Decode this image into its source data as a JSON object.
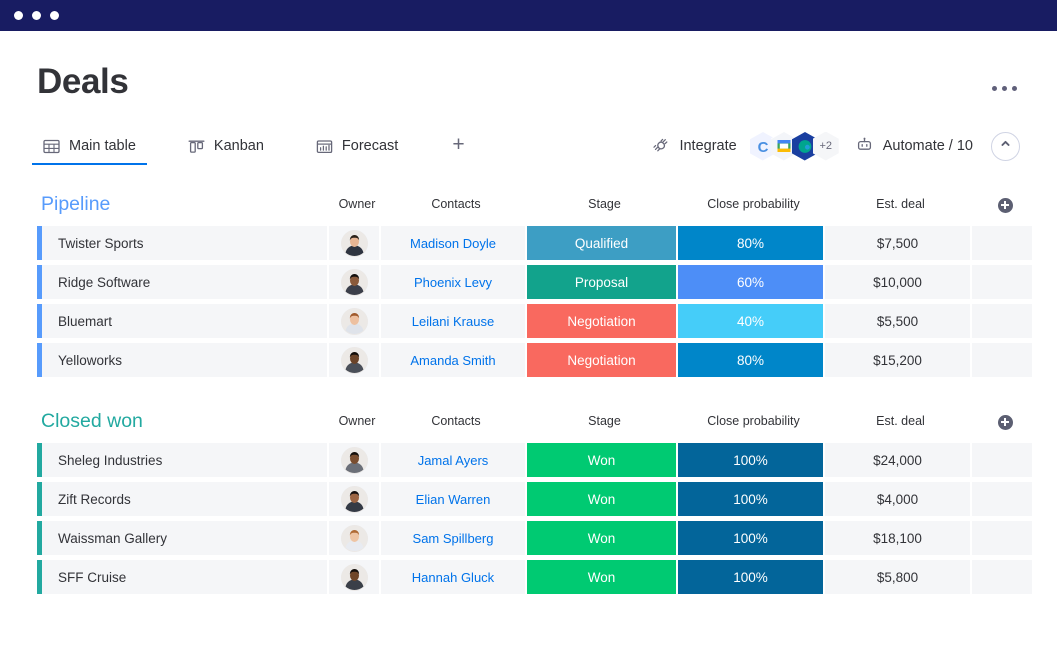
{
  "window": {
    "dots": [
      "dot-1",
      "dot-2",
      "dot-3"
    ],
    "bar_color": "#181c62"
  },
  "header": {
    "title": "Deals",
    "more_menu": "•••"
  },
  "tabs": [
    {
      "label": "Main table",
      "icon": "table-icon",
      "active": true
    },
    {
      "label": "Kanban",
      "icon": "kanban-icon",
      "active": false
    },
    {
      "label": "Forecast",
      "icon": "forecast-chart-icon",
      "active": false
    }
  ],
  "add_view_label": "+",
  "toolbar": {
    "integrate_label": "Integrate",
    "integrate_icon": "plug-icon",
    "integration_badges": [
      {
        "name": "copper-c-icon",
        "color": "#4a90e2"
      },
      {
        "name": "google-slides-icon",
        "color": "#f4b400"
      },
      {
        "name": "globe-teal-icon",
        "color": "#00a58e"
      }
    ],
    "integration_overflow": "+2",
    "automate_label": "Automate / 10",
    "automate_icon": "robot-icon",
    "collapse_icon": "chevron-up-icon"
  },
  "columns": [
    "",
    "Owner",
    "Contacts",
    "Stage",
    "Close probability",
    "Est. deal",
    ""
  ],
  "add_column_label": "add-column",
  "groups": [
    {
      "name": "Pipeline",
      "color": "#579bfc",
      "rows": [
        {
          "name": "Twister Sports",
          "owner": "owner-avatar-1",
          "contact": "Madison Doyle",
          "stage": "Qualified",
          "stage_color": "#3d9ec4",
          "probability": "80%",
          "probability_color": "#0086c9",
          "est_deal": "$7,500"
        },
        {
          "name": "Ridge Software",
          "owner": "owner-avatar-2",
          "contact": "Phoenix Levy",
          "stage": "Proposal",
          "stage_color": "#12a38c",
          "probability": "60%",
          "probability_color": "#4d8ef7",
          "est_deal": "$10,000"
        },
        {
          "name": "Bluemart",
          "owner": "owner-avatar-3",
          "contact": "Leilani Krause",
          "stage": "Negotiation",
          "stage_color": "#f9695f",
          "probability": "40%",
          "probability_color": "#45cdf9",
          "est_deal": "$5,500"
        },
        {
          "name": "Yelloworks",
          "owner": "owner-avatar-4",
          "contact": "Amanda Smith",
          "stage": "Negotiation",
          "stage_color": "#f9695f",
          "probability": "80%",
          "probability_color": "#0086c9",
          "est_deal": "$15,200"
        }
      ]
    },
    {
      "name": "Closed won",
      "color": "#22a9a0",
      "rows": [
        {
          "name": "Sheleg Industries",
          "owner": "owner-avatar-5",
          "contact": "Jamal Ayers",
          "stage": "Won",
          "stage_color": "#00ca72",
          "probability": "100%",
          "probability_color": "#03659a",
          "est_deal": "$24,000"
        },
        {
          "name": "Zift Records",
          "owner": "owner-avatar-6",
          "contact": "Elian Warren",
          "stage": "Won",
          "stage_color": "#00ca72",
          "probability": "100%",
          "probability_color": "#03659a",
          "est_deal": "$4,000"
        },
        {
          "name": "Waissman Gallery",
          "owner": "owner-avatar-7",
          "contact": "Sam Spillberg",
          "stage": "Won",
          "stage_color": "#00ca72",
          "probability": "100%",
          "probability_color": "#03659a",
          "est_deal": "$18,100"
        },
        {
          "name": "SFF Cruise",
          "owner": "owner-avatar-8",
          "contact": "Hannah Gluck",
          "stage": "Won",
          "stage_color": "#00ca72",
          "probability": "100%",
          "probability_color": "#03659a",
          "est_deal": "$5,800"
        }
      ]
    }
  ]
}
